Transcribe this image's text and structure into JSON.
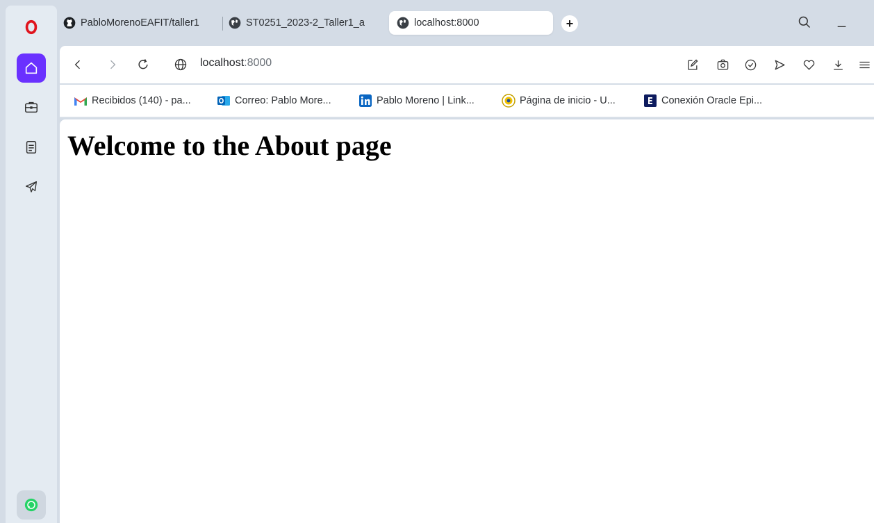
{
  "tabs": [
    {
      "label": "PabloMorenoEAFIT/taller1",
      "icon": "github-icon"
    },
    {
      "label": "ST0251_2023-2_Taller1_a",
      "icon": "globe-icon"
    },
    {
      "label": "localhost:8000",
      "icon": "globe-icon",
      "active": true
    }
  ],
  "new_tab_label": "+",
  "address": {
    "host": "localhost",
    "port": ":8000"
  },
  "bookmarks": [
    {
      "label": "Recibidos (140) - pa...",
      "icon": "gmail-icon"
    },
    {
      "label": "Correo: Pablo More...",
      "icon": "outlook-icon"
    },
    {
      "label": "Pablo Moreno | Link...",
      "icon": "linkedin-icon"
    },
    {
      "label": "Página de inicio - U...",
      "icon": "university-icon"
    },
    {
      "label": "Conexión Oracle Epi...",
      "icon": "epik-icon"
    }
  ],
  "page": {
    "heading": "Welcome to the About page"
  },
  "window": {
    "minimize_label": "_"
  },
  "colors": {
    "opera_red": "#ff1b2d",
    "home_active": "#6a31ff",
    "whatsapp": "#25d366"
  }
}
